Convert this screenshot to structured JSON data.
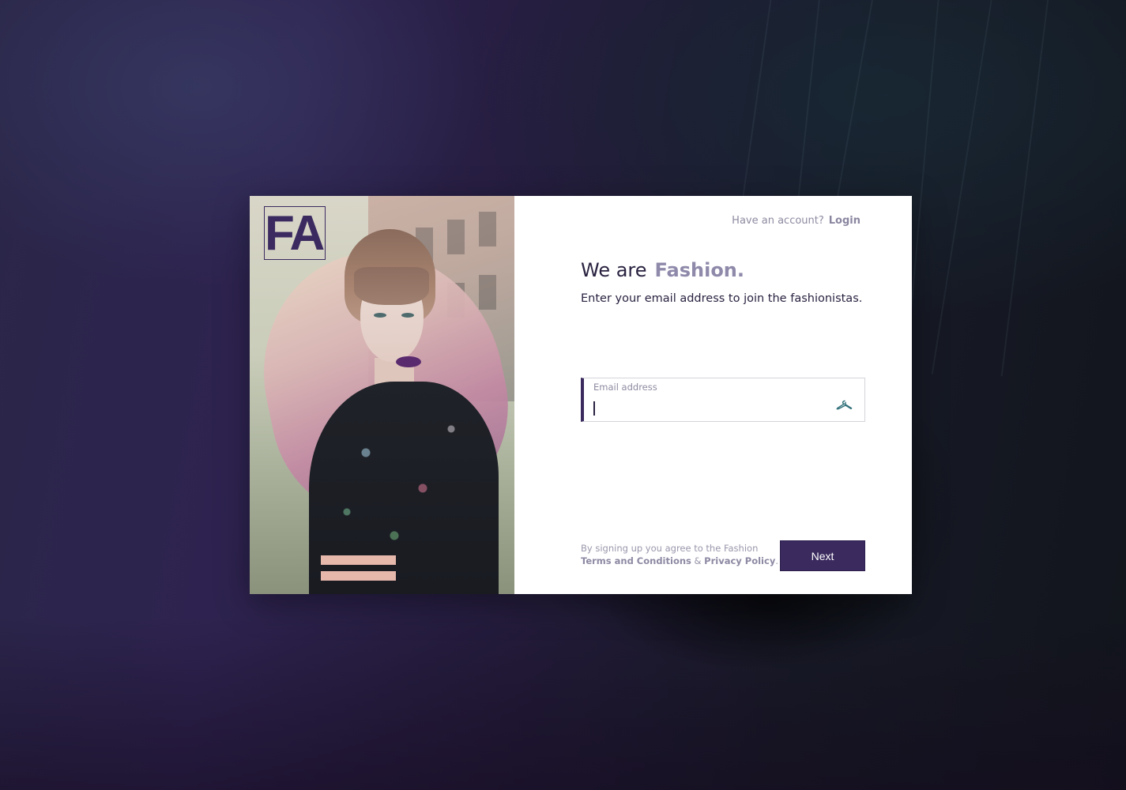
{
  "page": {
    "accent_color": "#3a2a5e",
    "muted_brand_color": "#8f89aa"
  },
  "hero": {
    "logo_text": "FA"
  },
  "header": {
    "account_prompt": "Have an account?",
    "login_label": "Login"
  },
  "intro": {
    "headline_prefix": "We are",
    "headline_brand": "Fashion.",
    "subtitle": "Enter your email address to join the fashionistas."
  },
  "email_field": {
    "label": "Email address",
    "value": "",
    "icon": "hanger-icon"
  },
  "footer": {
    "terms_prefix": "By signing up you agree to the Fashion",
    "terms_link": "Terms and Conditions",
    "terms_joiner": "&",
    "privacy_link": "Privacy Policy",
    "terms_suffix": ".",
    "next_label": "Next"
  }
}
